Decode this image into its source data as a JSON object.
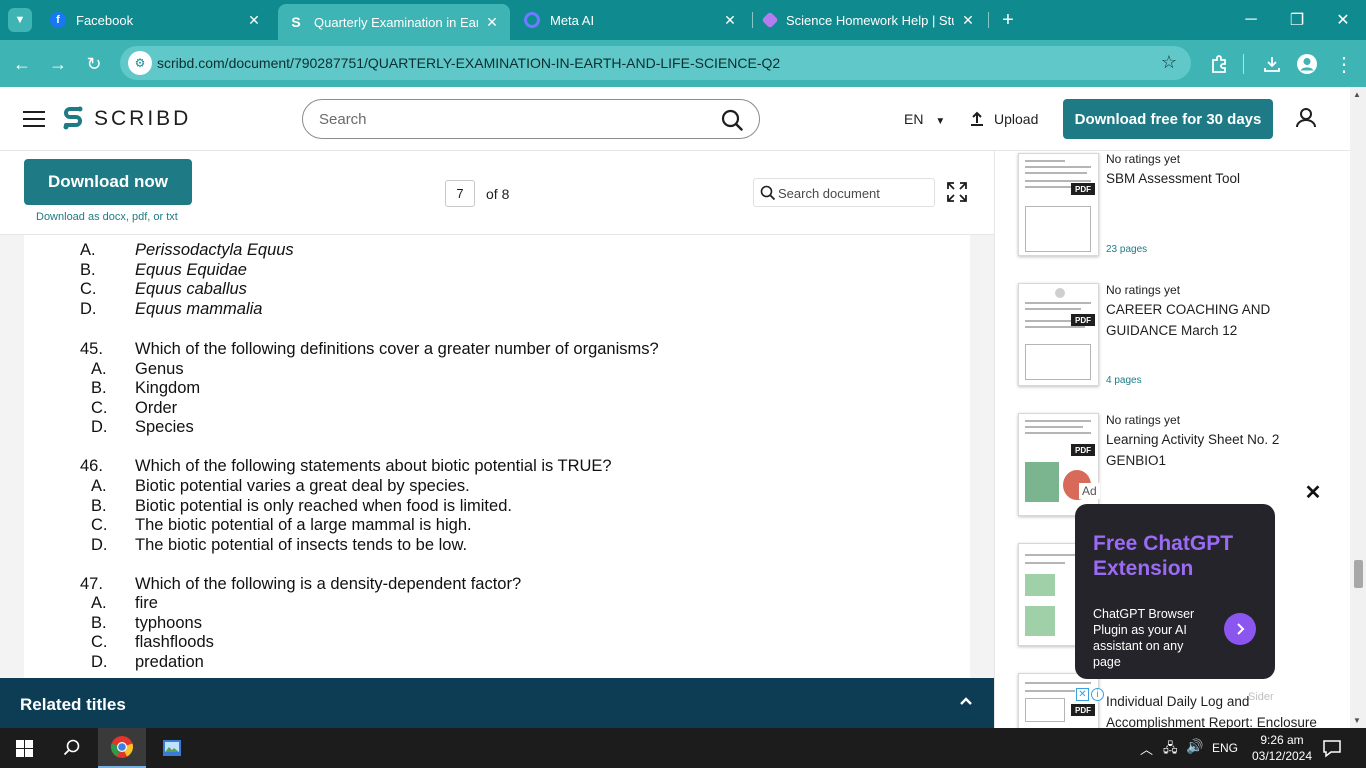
{
  "browser": {
    "tabs": [
      {
        "title": "Facebook",
        "favicon": "facebook-icon",
        "active": false
      },
      {
        "title": "Quarterly Examination in Earth and Life Science",
        "favicon": "scribd-icon",
        "active": true
      },
      {
        "title": "Meta AI",
        "favicon": "meta-ai-icon",
        "active": false
      },
      {
        "title": "Science Homework Help | Study.com",
        "favicon": "study-icon",
        "active": false
      }
    ],
    "url": "scribd.com/document/790287751/QUARTERLY-EXAMINATION-IN-EARTH-AND-LIFE-SCIENCE-Q2"
  },
  "header": {
    "logo_text": "SCRIBD",
    "search_placeholder": "Search",
    "language": "EN",
    "upload_label": "Upload",
    "download_trial_label": "Download free for 30 days"
  },
  "doc_toolbar": {
    "download_now_label": "Download now",
    "download_hint": "Download as docx, pdf, or txt",
    "current_page": "7",
    "page_total_label": "of 8",
    "search_doc_placeholder": "Search document"
  },
  "document": {
    "lines": [
      {
        "num": "A.",
        "text": "Perissodactyla Equus",
        "italic": true
      },
      {
        "num": "B.",
        "text": "Equus Equidae",
        "italic": true
      },
      {
        "num": "C.",
        "text": "Equus caballus",
        "italic": true
      },
      {
        "num": "D.",
        "text": "Equus mammalia",
        "italic": true
      },
      {
        "num": "45.",
        "text": "Which of the following definitions cover a greater number of organisms?",
        "italic": false
      },
      {
        "num": "A.",
        "text": "Genus",
        "italic": false
      },
      {
        "num": "B.",
        "text": "Kingdom",
        "italic": false
      },
      {
        "num": "C.",
        "text": "Order",
        "italic": false
      },
      {
        "num": "D.",
        "text": "Species",
        "italic": false
      },
      {
        "num": "46.",
        "text": "Which of the following statements about biotic potential is TRUE?",
        "italic": false
      },
      {
        "num": "A.",
        "text": "Biotic potential varies a great deal by species.",
        "italic": false
      },
      {
        "num": "B.",
        "text": "Biotic potential is only reached when food is limited.",
        "italic": false
      },
      {
        "num": "C.",
        "text": "The biotic potential of a large mammal is high.",
        "italic": false
      },
      {
        "num": "D.",
        "text": "The biotic potential of insects tends to be low.",
        "italic": false
      },
      {
        "num": "47.",
        "text": "Which of the following is a density-dependent factor?",
        "italic": false
      },
      {
        "num": "A.",
        "text": "fire",
        "italic": false
      },
      {
        "num": "B.",
        "text": "typhoons",
        "italic": false
      },
      {
        "num": "C.",
        "text": "flashfloods",
        "italic": false
      },
      {
        "num": "D.",
        "text": "predation",
        "italic": false
      }
    ]
  },
  "related_bar": {
    "title": "Related titles"
  },
  "sidebar": {
    "docs": [
      {
        "rating": "No ratings yet",
        "title": "SBM Assessment Tool",
        "pages": "23 pages",
        "badge": "PDF"
      },
      {
        "rating": "No ratings yet",
        "title": "CAREER COACHING AND GUIDANCE March 12",
        "pages": "4 pages",
        "badge": "PDF"
      },
      {
        "rating": "No ratings yet",
        "title": "Learning Activity Sheet No. 2 GENBIO1",
        "pages": "",
        "badge": "PDF"
      },
      {
        "rating": "",
        "title": "Individual Daily Log and Accomplishment Report: Enclosure",
        "pages": "",
        "badge": "PDF"
      }
    ]
  },
  "ad": {
    "tag": "Ad",
    "headline": "Free ChatGPT Extension",
    "body": "ChatGPT Browser Plugin as your AI assistant on any page",
    "brand": "Sider",
    "accent": "#9b6bf5"
  },
  "taskbar": {
    "language": "ENG",
    "time": "9:26 am",
    "date": "03/12/2024"
  }
}
